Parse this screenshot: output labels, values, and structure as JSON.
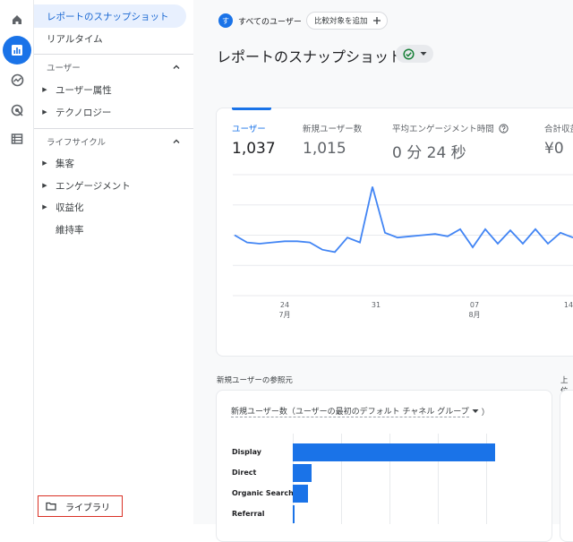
{
  "nav": {
    "snapshot": "レポートのスナップショット",
    "realtime": "リアルタイム",
    "user_section": "ユーザー",
    "user_attr": "ユーザー属性",
    "technology": "テクノロジー",
    "lifecycle_section": "ライフサイクル",
    "acquisition": "集客",
    "engagement": "エンゲージメント",
    "monetization": "収益化",
    "retention": "維持率",
    "library": "ライブラリ"
  },
  "header": {
    "avatar_letter": "す",
    "all_users": "すべてのユーザー",
    "compare": "比較対象を追加",
    "title": "レポートのスナップショット"
  },
  "metrics": [
    {
      "label": "ユーザー",
      "value": "1,037"
    },
    {
      "label": "新規ユーザー数",
      "value": "1,015"
    },
    {
      "label": "平均エンゲージメント時間",
      "value": "0 分 24 秒"
    },
    {
      "label": "合計収益",
      "value": "¥0"
    }
  ],
  "chart_data": {
    "type": "line",
    "x_tick_labels": [
      "24",
      "7月",
      "31",
      "07",
      "8月",
      "14"
    ],
    "series": [
      {
        "values": [
          50,
          44,
          43,
          44,
          45,
          45,
          44,
          38,
          36,
          48,
          44,
          90,
          52,
          48,
          49,
          50,
          51,
          49,
          55,
          40,
          55,
          43,
          54,
          43,
          55,
          43,
          52,
          48
        ]
      }
    ]
  },
  "referral": {
    "title": "新規ユーザーの参照元",
    "dropdown": "新規ユーザー数（ユーザーの最初のデフォルト チャネル グループ",
    "right_title": "上位",
    "chart_data": {
      "type": "bar",
      "categories": [
        "Display",
        "Direct",
        "Organic Search",
        "Referral"
      ],
      "values": [
        720,
        66,
        55,
        6
      ]
    }
  }
}
